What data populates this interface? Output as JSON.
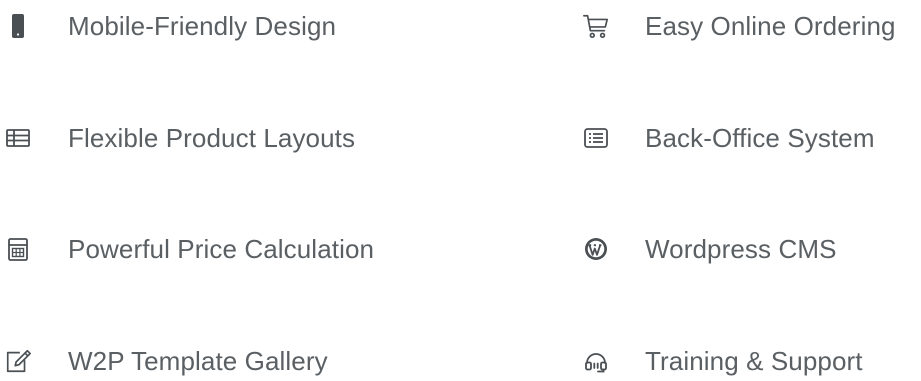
{
  "features": {
    "left": [
      {
        "label": "Mobile-Friendly Design",
        "icon": "mobile-phone-icon"
      },
      {
        "label": "Flexible Product Layouts",
        "icon": "table-layout-icon"
      },
      {
        "label": "Powerful Price Calculation",
        "icon": "calculator-icon"
      },
      {
        "label": "W2P Template Gallery",
        "icon": "edit-pencil-icon"
      }
    ],
    "right": [
      {
        "label": "Easy Online Ordering",
        "icon": "shopping-cart-icon"
      },
      {
        "label": "Back-Office System",
        "icon": "list-icon"
      },
      {
        "label": "Wordpress CMS",
        "icon": "wordpress-icon"
      },
      {
        "label": "Training & Support",
        "icon": "headset-support-icon"
      }
    ]
  },
  "colors": {
    "text": "#5a5f63",
    "icon": "#4a4f53"
  }
}
